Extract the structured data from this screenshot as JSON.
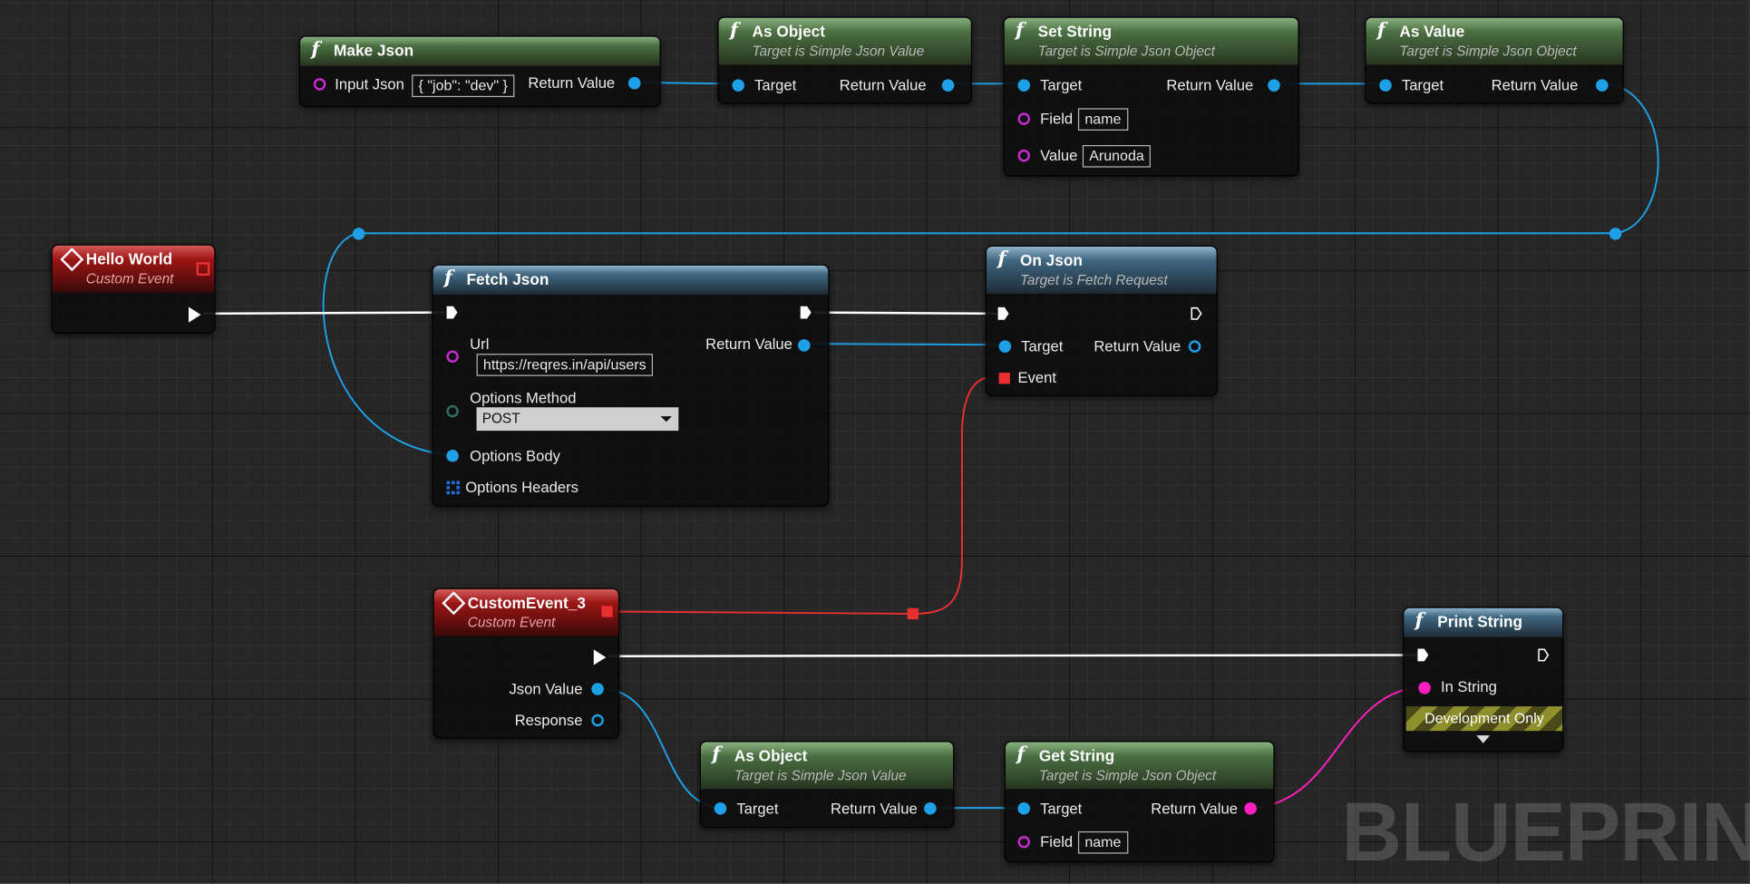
{
  "nodes": {
    "make_json": {
      "title": "Make Json",
      "input_json_label": "Input Json",
      "input_json_value": "{ \"job\": \"dev\" }",
      "return_label": "Return Value"
    },
    "as_object_top": {
      "title": "As Object",
      "subtitle": "Target is Simple Json Value",
      "target_label": "Target",
      "return_label": "Return Value"
    },
    "set_string": {
      "title": "Set String",
      "subtitle": "Target is Simple Json Object",
      "target_label": "Target",
      "return_label": "Return Value",
      "field_label": "Field",
      "field_value": "name",
      "value_label": "Value",
      "value_value": "Arunoda"
    },
    "as_value": {
      "title": "As Value",
      "subtitle": "Target is Simple Json Object",
      "target_label": "Target",
      "return_label": "Return Value"
    },
    "hello_world": {
      "title": "Hello World",
      "subtitle": "Custom Event"
    },
    "fetch_json": {
      "title": "Fetch Json",
      "url_label": "Url",
      "url_value": "https://reqres.in/api/users",
      "return_label": "Return Value",
      "method_label": "Options Method",
      "method_value": "POST",
      "body_label": "Options Body",
      "headers_label": "Options Headers"
    },
    "on_json": {
      "title": "On Json",
      "subtitle": "Target is Fetch Request",
      "target_label": "Target",
      "return_label": "Return Value",
      "event_label": "Event"
    },
    "custom_event_3": {
      "title": "CustomEvent_3",
      "subtitle": "Custom Event",
      "json_value_label": "Json Value",
      "response_label": "Response"
    },
    "print_string": {
      "title": "Print String",
      "in_string_label": "In String",
      "dev_only_label": "Development Only"
    },
    "as_object_bottom": {
      "title": "As Object",
      "subtitle": "Target is Simple Json Value",
      "target_label": "Target",
      "return_label": "Return Value"
    },
    "get_string": {
      "title": "Get String",
      "subtitle": "Target is Simple Json Object",
      "target_label": "Target",
      "return_label": "Return Value",
      "field_label": "Field",
      "field_value": "name"
    }
  },
  "watermark": "BLUEPRINT",
  "colors": {
    "object_wire": "#1da0e6",
    "exec_wire": "#ffffff",
    "event_wire": "#e83030",
    "string_wire": "#ff1fbf",
    "function_header": "#4a7042",
    "impure_header": "#3f6680",
    "event_header": "#9c1414"
  },
  "icons": {
    "function": "function-f-icon",
    "event": "event-diamond-icon"
  }
}
